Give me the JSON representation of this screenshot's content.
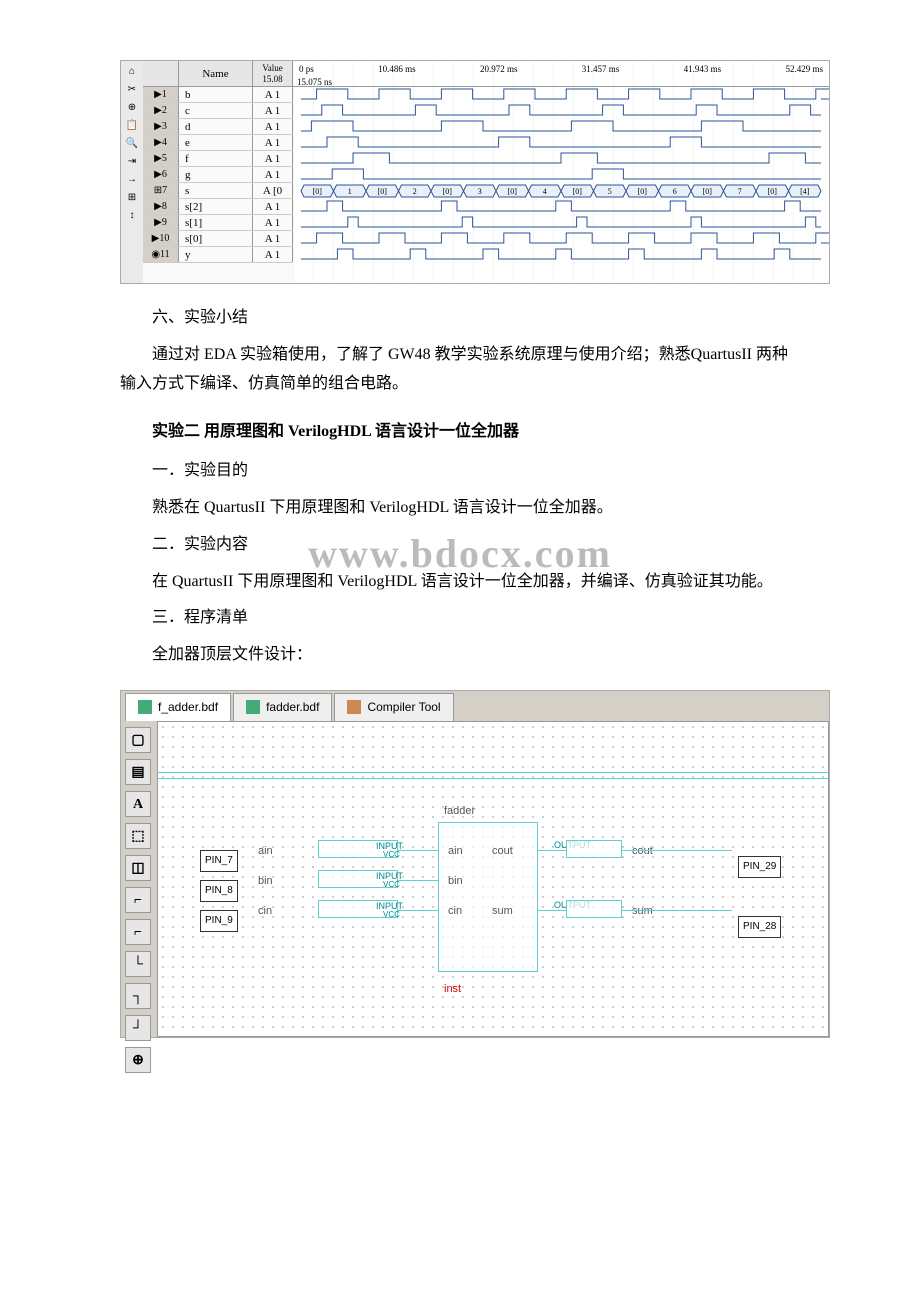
{
  "waveform": {
    "header": {
      "name": "Name",
      "value": "Value\n15.08"
    },
    "times": [
      "0 ps",
      "10.486 ms",
      "20.972 ms",
      "31.457 ms",
      "41.943 ms",
      "52.429 ms"
    ],
    "cursor": "15.075 ns",
    "signals": [
      {
        "idx": "1",
        "name": "b",
        "value": "A 1",
        "icon": "▶"
      },
      {
        "idx": "2",
        "name": "c",
        "value": "A 1",
        "icon": "▶"
      },
      {
        "idx": "3",
        "name": "d",
        "value": "A 1",
        "icon": "▶"
      },
      {
        "idx": "4",
        "name": "e",
        "value": "A 1",
        "icon": "▶"
      },
      {
        "idx": "5",
        "name": "f",
        "value": "A 1",
        "icon": "▶"
      },
      {
        "idx": "6",
        "name": "g",
        "value": "A 1",
        "icon": "▶"
      },
      {
        "idx": "7",
        "name": "s",
        "value": "A [0",
        "icon": "⊞"
      },
      {
        "idx": "8",
        "name": "  s[2]",
        "value": "A 1",
        "icon": "▶"
      },
      {
        "idx": "9",
        "name": "  s[1]",
        "value": "A 1",
        "icon": "▶"
      },
      {
        "idx": "10",
        "name": "  s[0]",
        "value": "A 1",
        "icon": "▶"
      },
      {
        "idx": "11",
        "name": "y",
        "value": "A 1",
        "icon": "◉"
      }
    ],
    "bus_values": [
      "[0]",
      "1",
      "[0]",
      "2",
      "[0]",
      "3",
      "[0]",
      "4",
      "[0]",
      "5",
      "[0]",
      "6",
      "[0]",
      "7",
      "[0]",
      "[4]"
    ]
  },
  "text": {
    "section6": "六、实验小结",
    "para1": "通过对 EDA 实验箱使用，了解了 GW48 教学实验系统原理与使用介绍；熟悉QuartusII 两种输入方式下编译、仿真简单的组合电路。",
    "exp2_title": "实验二 用原理图和 VerilogHDL 语言设计一位全加器",
    "sec2_1": "一．实验目的",
    "sec2_1_body": "熟悉在 QuartusII 下用原理图和 VerilogHDL 语言设计一位全加器。",
    "sec2_2": "二．实验内容",
    "sec2_2_body": "在 QuartusII 下用原理图和 VerilogHDL 语言设计一位全加器，并编译、仿真验证其功能。",
    "sec2_3": "三．程序清单",
    "sec2_3_body": "全加器顶层文件设计：",
    "watermark": "www.bdocx.com"
  },
  "schematic": {
    "tabs": [
      {
        "label": "f_adder.bdf",
        "active": true,
        "icon": "bdf"
      },
      {
        "label": "fadder.bdf",
        "active": false,
        "icon": "bdf"
      },
      {
        "label": "Compiler Tool",
        "active": false,
        "icon": "comp"
      }
    ],
    "block_name": "fadder",
    "inst_name": "inst",
    "inputs": [
      {
        "name": "ain",
        "pin": "PIN_7",
        "port": "ain",
        "io": "INPUT",
        "vcc": "VCC"
      },
      {
        "name": "bin",
        "pin": "PIN_8",
        "port": "bin",
        "io": "INPUT",
        "vcc": "VCC"
      },
      {
        "name": "cin",
        "pin": "PIN_9",
        "port": "cin",
        "io": "INPUT",
        "vcc": "VCC"
      }
    ],
    "outputs": [
      {
        "name": "cout",
        "pin": "PIN_29",
        "port": "cout",
        "io": "OUTPUT"
      },
      {
        "name": "sum",
        "pin": "PIN_28",
        "port": "sum",
        "io": "OUTPUT"
      }
    ],
    "tools": [
      "▢",
      "▤",
      "A",
      "⬚",
      "◫",
      "⌐",
      "⌐",
      "└",
      "┐",
      "┘",
      "⊕"
    ]
  }
}
